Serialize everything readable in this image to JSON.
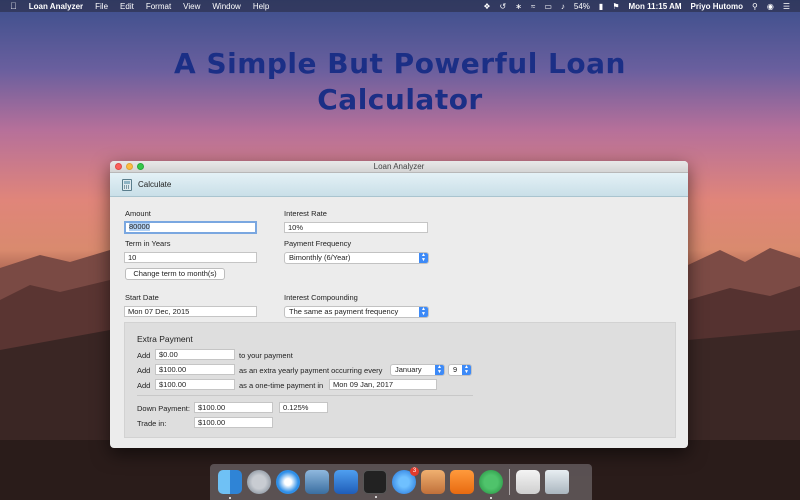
{
  "menubar": {
    "app_name": "Loan Analyzer",
    "menus": [
      "File",
      "Edit",
      "Format",
      "View",
      "Window",
      "Help"
    ],
    "battery": "54%",
    "clock": "Mon 11:15 AM",
    "user": "Priyo Hutomo"
  },
  "hero": {
    "line1": "A Simple But Powerful Loan",
    "line2": "Calculator"
  },
  "window": {
    "title": "Loan Analyzer",
    "toolbar": {
      "calculate_label": "Calculate",
      "calculate_icon": "calculator-icon"
    },
    "amount": {
      "label": "Amount",
      "value": "80000"
    },
    "interest_rate": {
      "label": "Interest Rate",
      "value": "10%"
    },
    "term": {
      "label": "Term in Years",
      "value": "10",
      "button": "Change term to month(s)"
    },
    "payment_frequency": {
      "label": "Payment Frequency",
      "value": "Bimonthly (6/Year)"
    },
    "start_date": {
      "label": "Start Date",
      "value": "Mon 07 Dec, 2015"
    },
    "interest_compounding": {
      "label": "Interest Compounding",
      "value": "The same as payment frequency"
    },
    "extra_payment": {
      "title": "Extra Payment",
      "row1": {
        "add": "Add",
        "value": "$0.00",
        "suffix": "to your payment"
      },
      "row2": {
        "add": "Add",
        "value": "$100.00",
        "suffix": "as an extra yearly payment occurring every",
        "month": "January",
        "day": "9"
      },
      "row3": {
        "add": "Add",
        "value": "$100.00",
        "suffix": "as a one-time payment in",
        "date": "Mon 09 Jan, 2017"
      },
      "down_payment": {
        "label": "Down Payment:",
        "value": "$100.00",
        "percent": "0.125%"
      },
      "trade_in": {
        "label": "Trade in:",
        "value": "$100.00"
      }
    }
  },
  "colors": {
    "accent": "#3d8af7",
    "hero_text": "#1b2f86",
    "toolbar_bg": "#d6e8ef"
  }
}
